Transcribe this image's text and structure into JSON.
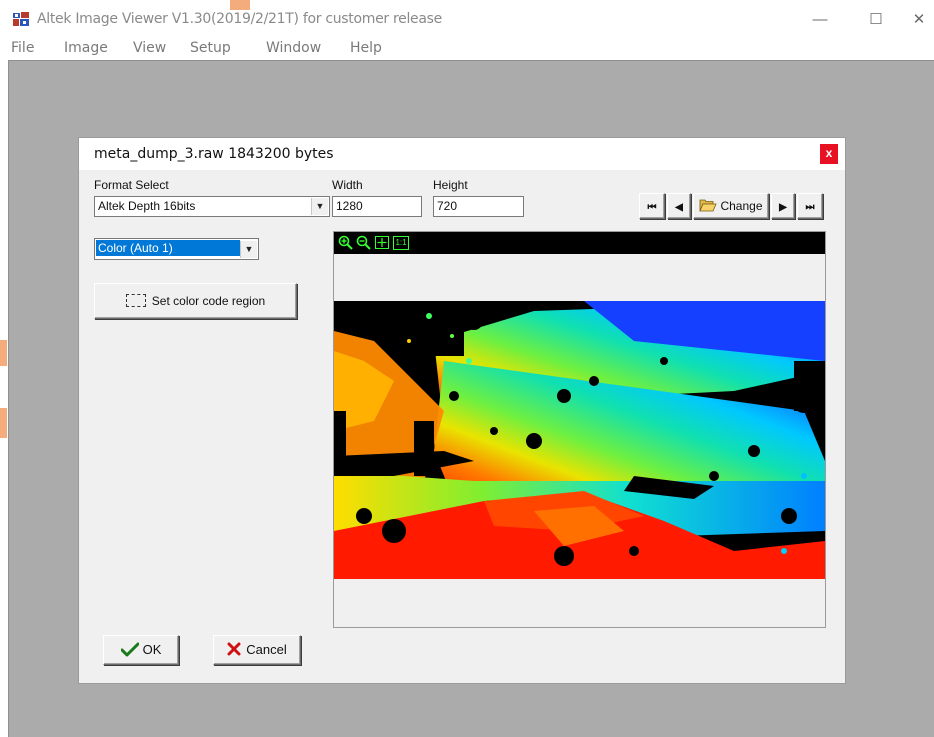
{
  "window": {
    "title": "Altek Image Viewer V1.30(2019/2/21T)  for customer release",
    "controls": {
      "minimize": "—",
      "maximize": "☐",
      "close": "✕"
    }
  },
  "menu": [
    "File",
    "Image",
    "View",
    "Setup",
    "Window",
    "Help"
  ],
  "dialog": {
    "title": "meta_dump_3.raw 1843200 bytes",
    "close": "x",
    "format": {
      "label": "Format Select",
      "value": "Altek Depth 16bits"
    },
    "width": {
      "label": "Width",
      "value": "1280"
    },
    "height": {
      "label": "Height",
      "value": "720"
    },
    "color_mode": {
      "value": "Color (Auto 1)"
    },
    "set_region_button": "Set color code region",
    "nav": {
      "first": "⏮",
      "prev": "◀",
      "change": "Change",
      "next": "▶",
      "last": "⏭"
    },
    "viewer_toolbar": {
      "zoom_in": "+",
      "zoom_out": "−",
      "fit": "⊡",
      "actual": "1:1"
    },
    "ok_button": "OK",
    "cancel_button": "Cancel"
  },
  "icons": [
    "app-icon",
    "folder-open-icon",
    "checkmark-icon",
    "cross-icon",
    "dashed-rect-icon",
    "zoom-in-icon",
    "zoom-out-icon",
    "fit-icon",
    "actual-size-icon"
  ],
  "colors": {
    "dialog_close": "#e81123",
    "selection": "#0078d7",
    "mdi_background": "#ababab",
    "toolbar_icon": "#33ff33"
  }
}
